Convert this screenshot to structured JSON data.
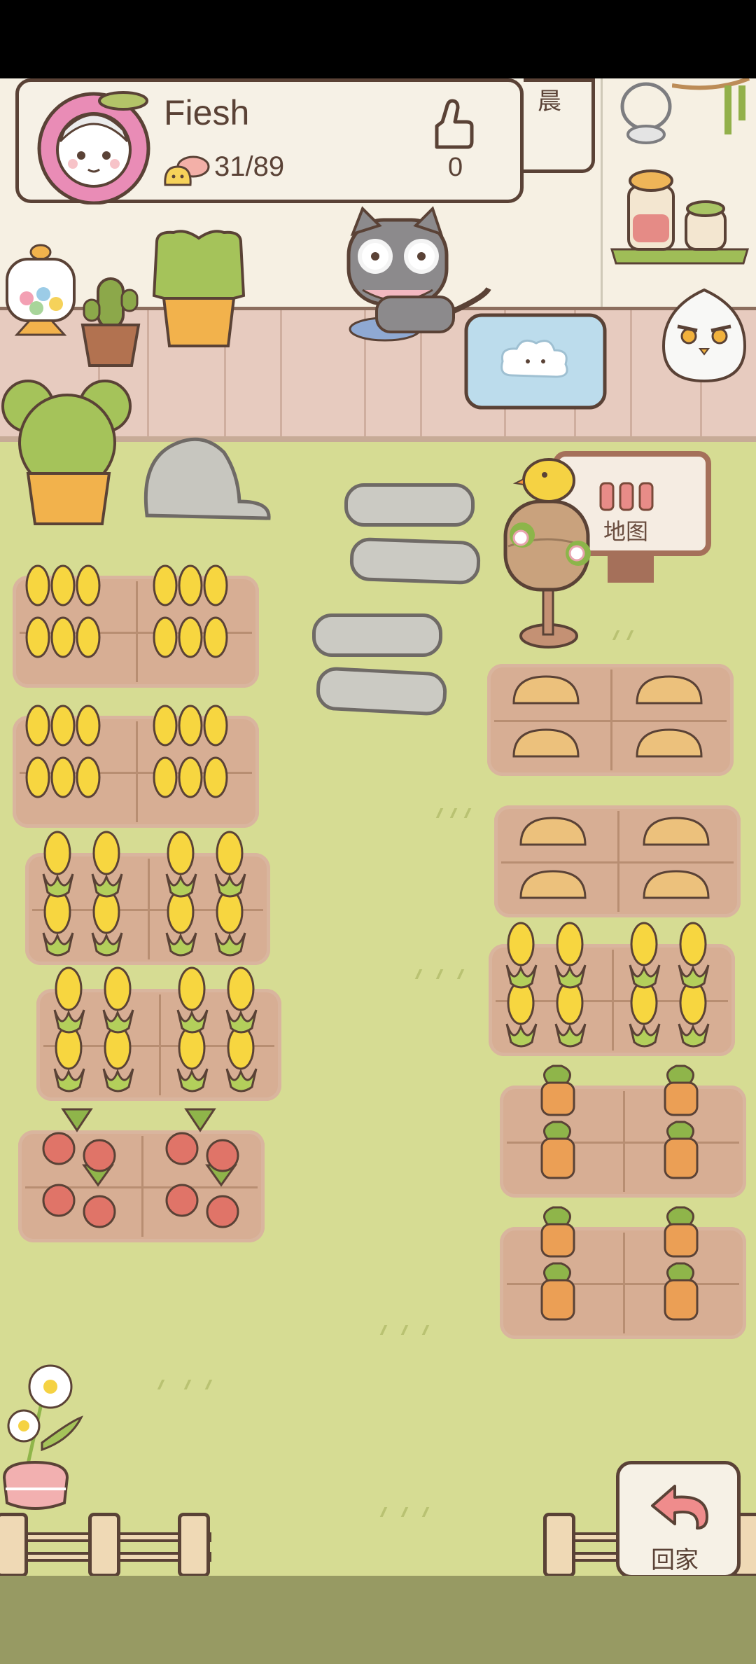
{
  "status_bar": {},
  "profile": {
    "player_name": "Fiesh",
    "collection_count": "31/89",
    "likes_count": "0"
  },
  "signpost": {
    "label": "地图"
  },
  "home_button": {
    "label": "回家"
  },
  "notice_panel": {
    "partial_text": "晨"
  },
  "crops": {
    "left_fields": [
      "wheat",
      "wheat",
      "corn",
      "corn",
      "tomato"
    ],
    "right_fields": [
      "potato",
      "potato",
      "corn",
      "carrot",
      "carrot"
    ]
  },
  "colors": {
    "grass": "#d6dc93",
    "soil": "#d7ae94",
    "outline": "#5a4236",
    "panel": "#f6f1e6",
    "bottom_bar": "#979a63"
  }
}
